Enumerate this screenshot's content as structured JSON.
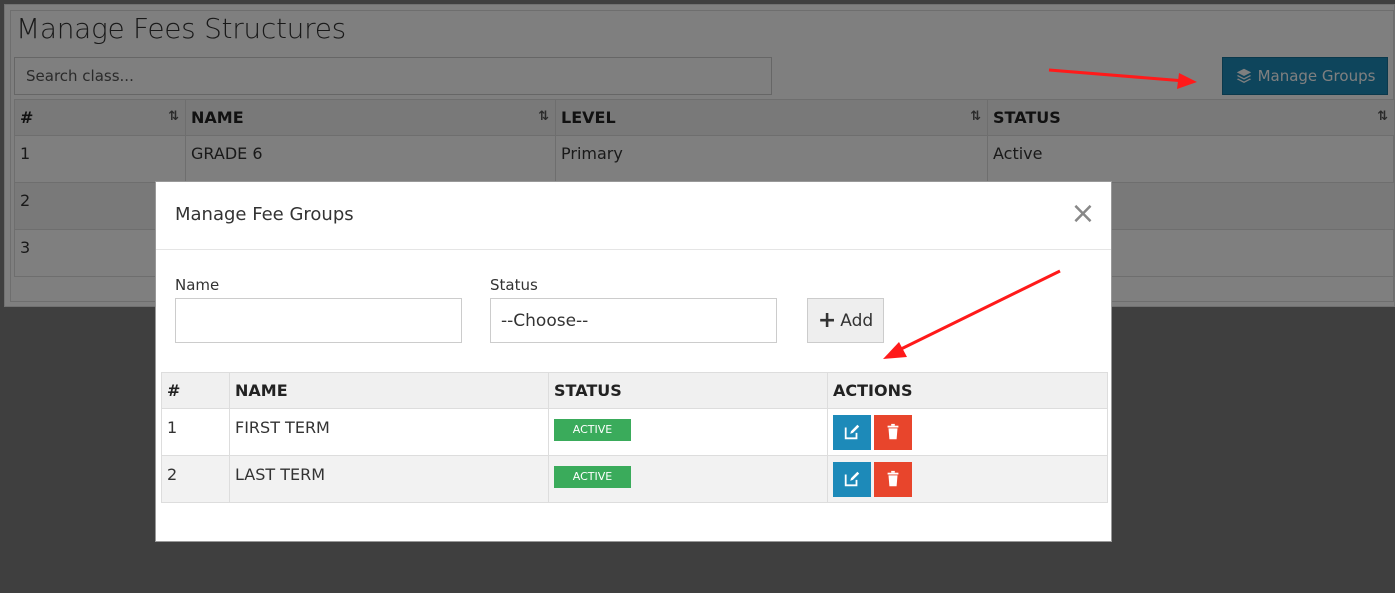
{
  "page": {
    "title": "Manage Fees Structures",
    "search_placeholder": "Search class...",
    "manage_groups_label": "Manage Groups",
    "manage_groups_icon": "layers-icon"
  },
  "classes_table": {
    "headers": [
      "#",
      "NAME",
      "LEVEL",
      "STATUS"
    ],
    "rows": [
      {
        "num": "1",
        "name": "GRADE 6",
        "level": "Primary",
        "status": "Active"
      },
      {
        "num": "2",
        "name": "",
        "level": "",
        "status": ""
      },
      {
        "num": "3",
        "name": "",
        "level": "",
        "status": ""
      }
    ]
  },
  "modal": {
    "title": "Manage Fee Groups",
    "close_symbol": "×",
    "name_label": "Name",
    "name_value": "",
    "status_label": "Status",
    "status_selected": "--Choose--",
    "add_label": "Add",
    "table": {
      "headers": [
        "#",
        "NAME",
        "STATUS",
        "ACTIONS"
      ],
      "rows": [
        {
          "num": "1",
          "name": "FIRST TERM",
          "status": "ACTIVE"
        },
        {
          "num": "2",
          "name": "LAST TERM",
          "status": "ACTIVE"
        }
      ]
    }
  },
  "colors": {
    "primary": "#1d8ab9",
    "danger": "#e8452c",
    "success": "#3aab5b",
    "annotation_arrow": "#ff1a1a"
  }
}
